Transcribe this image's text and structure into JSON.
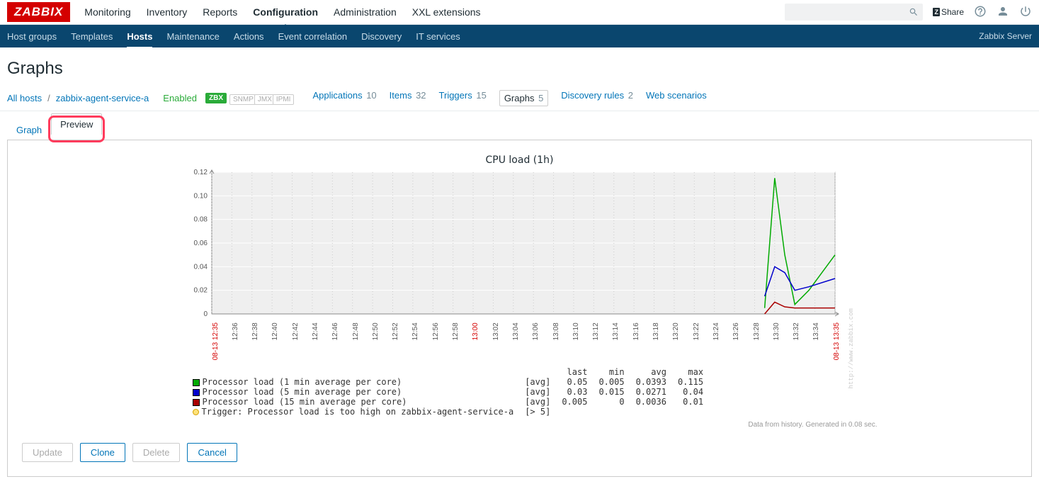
{
  "logo": "ZABBIX",
  "topnav": {
    "items": [
      "Monitoring",
      "Inventory",
      "Reports",
      "Configuration",
      "Administration",
      "XXL extensions"
    ],
    "active": "Configuration",
    "share": "Share",
    "server_label": "Zabbix Server"
  },
  "subnav": {
    "items": [
      "Host groups",
      "Templates",
      "Hosts",
      "Maintenance",
      "Actions",
      "Event correlation",
      "Discovery",
      "IT services"
    ],
    "active": "Hosts"
  },
  "page_title": "Graphs",
  "hostbar": {
    "all_hosts": "All hosts",
    "hostname": "zabbix-agent-service-a",
    "enabled": "Enabled",
    "zbx": "ZBX",
    "badges": [
      "SNMP",
      "JMX",
      "IPMI"
    ],
    "links": [
      {
        "label": "Applications",
        "count": "10"
      },
      {
        "label": "Items",
        "count": "32"
      },
      {
        "label": "Triggers",
        "count": "15"
      },
      {
        "label": "Graphs",
        "count": "5"
      },
      {
        "label": "Discovery rules",
        "count": "2"
      },
      {
        "label": "Web scenarios",
        "count": ""
      }
    ],
    "selected": "Graphs"
  },
  "tabs": {
    "graph": "Graph",
    "preview": "Preview"
  },
  "chart_data": {
    "type": "line",
    "title": "CPU load (1h)",
    "ylim": [
      0,
      0.12
    ],
    "yticks": [
      0,
      0.02,
      0.04,
      0.06,
      0.08,
      0.1,
      0.12
    ],
    "xticks": [
      "08-13 12:35",
      "12:36",
      "12:38",
      "12:40",
      "12:42",
      "12:44",
      "12:46",
      "12:48",
      "12:50",
      "12:52",
      "12:54",
      "12:56",
      "12:58",
      "13:00",
      "13:02",
      "13:04",
      "13:06",
      "13:08",
      "13:10",
      "13:12",
      "13:14",
      "13:16",
      "13:18",
      "13:20",
      "13:22",
      "13:24",
      "13:26",
      "13:28",
      "13:30",
      "13:32",
      "13:34",
      "08-13 13:35"
    ],
    "xticks_red": [
      "08-13 12:35",
      "13:00",
      "08-13 13:35"
    ],
    "series": [
      {
        "name": "Processor load (1 min average per core)",
        "color": "#00AA00",
        "agg": "[avg]",
        "last": "0.05",
        "min": "0.005",
        "avg": "0.0393",
        "max": "0.115",
        "values_tail": {
          "13:29": 0.005,
          "13:30": 0.115,
          "13:31": 0.05,
          "13:32": 0.008,
          "13:33": 0.02,
          "13:35": 0.05
        }
      },
      {
        "name": "Processor load (5 min average per core)",
        "color": "#0000CC",
        "agg": "[avg]",
        "last": "0.03",
        "min": "0.015",
        "avg": "0.0271",
        "max": "0.04",
        "values_tail": {
          "13:29": 0.015,
          "13:30": 0.04,
          "13:31": 0.035,
          "13:32": 0.02,
          "13:33": 0.023,
          "13:35": 0.03
        }
      },
      {
        "name": "Processor load (15 min average per core)",
        "color": "#AA0000",
        "agg": "[avg]",
        "last": "0.005",
        "min": "0",
        "avg": "0.0036",
        "max": "0.01",
        "values_tail": {
          "13:29": 0.0,
          "13:30": 0.01,
          "13:31": 0.006,
          "13:32": 0.005,
          "13:33": 0.005,
          "13:35": 0.005
        }
      }
    ],
    "trigger": {
      "label": "Trigger: Processor load is too high on zabbix-agent-service-a",
      "cond": "[> 5]"
    },
    "legend_headers": [
      "last",
      "min",
      "avg",
      "max"
    ],
    "footer": "Data from history. Generated in 0.08 sec.",
    "watermark": "http://www.zabbix.com"
  },
  "buttons": {
    "update": "Update",
    "clone": "Clone",
    "delete": "Delete",
    "cancel": "Cancel"
  }
}
